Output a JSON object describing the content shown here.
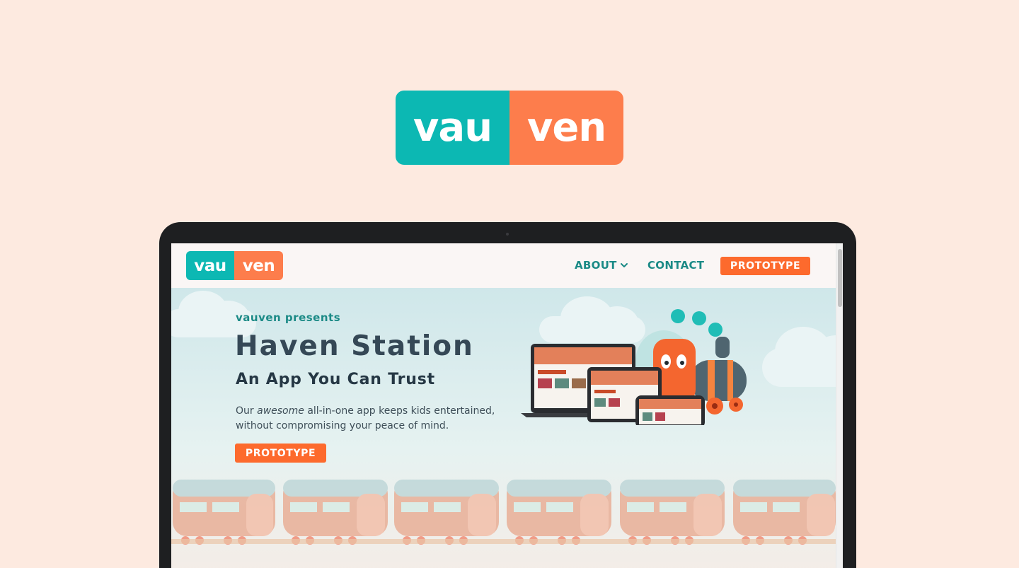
{
  "brand": {
    "logo_left": "vau",
    "logo_right": "ven",
    "teal": "#0cb8b3",
    "orange": "#fd7d4c"
  },
  "nav": {
    "about_label": "ABOUT",
    "contact_label": "CONTACT",
    "prototype_label": "PROTOTYPE"
  },
  "hero": {
    "presents": "vauven presents",
    "title": "Haven Station",
    "subtitle": "An App You Can Trust",
    "desc_before": "Our ",
    "desc_em": "awesome",
    "desc_after": " all-in-one app keeps kids entertained, without compromising your peace of mind.",
    "cta_label": "PROTOTYPE"
  },
  "colors": {
    "page_bg": "#fdeae0",
    "nav_text": "#1b8a86",
    "cta": "#fd6a2d",
    "title": "#354856"
  }
}
